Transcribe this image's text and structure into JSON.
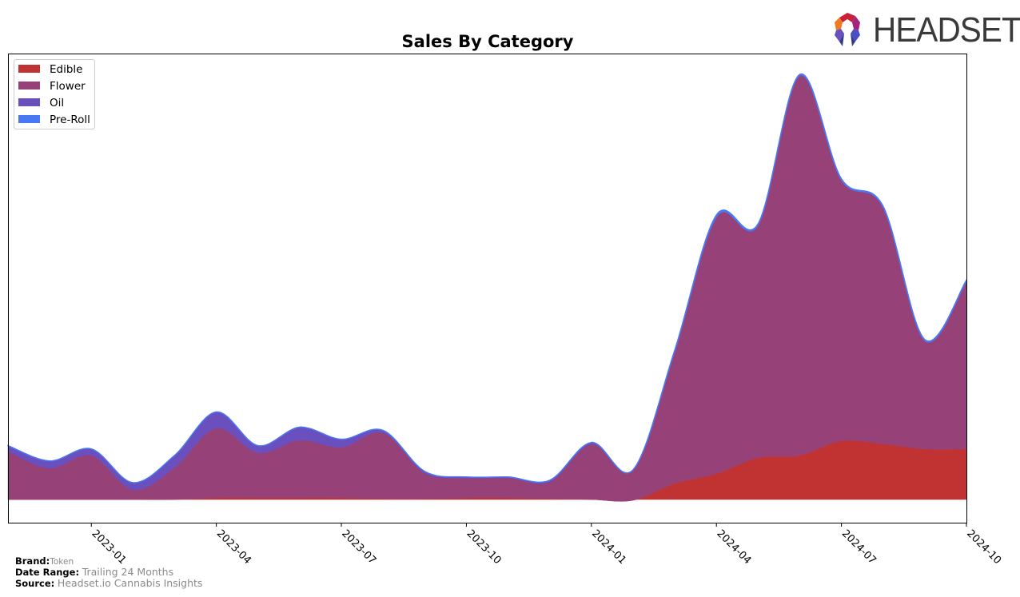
{
  "header": {
    "logo_text": "HEADSET",
    "logo_icon": "headset-logo-icon"
  },
  "footer": {
    "brand_label": "Brand:",
    "brand_value": "Token",
    "date_range_label": "Date Range:",
    "date_range_value": "Trailing 24 Months",
    "source_label": "Source:",
    "source_value": "Headset.io Cannabis Insights"
  },
  "chart_data": {
    "type": "area",
    "stacked": true,
    "smoothed": true,
    "title": "Sales By Category",
    "xlabel": "",
    "ylabel": "",
    "y_units": "relative sales (no y-axis labels shown)",
    "ylim": [
      -20,
      555
    ],
    "grid": false,
    "legend_position": "top-left",
    "x": [
      "2022-11",
      "2022-12",
      "2023-01",
      "2023-02",
      "2023-03",
      "2023-04",
      "2023-05",
      "2023-06",
      "2023-07",
      "2023-08",
      "2023-09",
      "2023-10",
      "2023-11",
      "2023-12",
      "2024-01",
      "2024-02",
      "2024-03",
      "2024-04",
      "2024-05",
      "2024-06",
      "2024-07",
      "2024-08",
      "2024-09",
      "2024-10"
    ],
    "x_ticks": [
      "2023-01",
      "2023-04",
      "2023-07",
      "2023-10",
      "2024-01",
      "2024-04",
      "2024-07",
      "2024-10"
    ],
    "series": [
      {
        "name": "Edible",
        "color": "#c13333",
        "values": [
          0,
          0,
          0,
          0,
          0,
          2,
          2,
          2,
          2,
          1,
          1,
          2,
          2,
          1,
          0,
          -1,
          20,
          32,
          52,
          55,
          73,
          69,
          63,
          63
        ]
      },
      {
        "name": "Flower",
        "color": "#964178",
        "values": [
          60,
          39,
          55,
          12,
          40,
          87,
          56,
          72,
          63,
          82,
          32,
          25,
          25,
          21,
          69,
          38,
          165,
          320,
          290,
          473,
          325,
          295,
          135,
          209
        ]
      },
      {
        "name": "Oil",
        "color": "#6a4fbf",
        "values": [
          7,
          9,
          8,
          9,
          15,
          20,
          9,
          16,
          10,
          3,
          2,
          1,
          1,
          2,
          2,
          0,
          0,
          0,
          0,
          0,
          0,
          0,
          0,
          0
        ]
      },
      {
        "name": "Pre-Roll",
        "color": "#4a78f5",
        "values": [
          0,
          0,
          0,
          0,
          0,
          0,
          0,
          0,
          0,
          0,
          0,
          0,
          0,
          0,
          0,
          0,
          1,
          2,
          1,
          1,
          1,
          1,
          1,
          1
        ]
      }
    ]
  }
}
